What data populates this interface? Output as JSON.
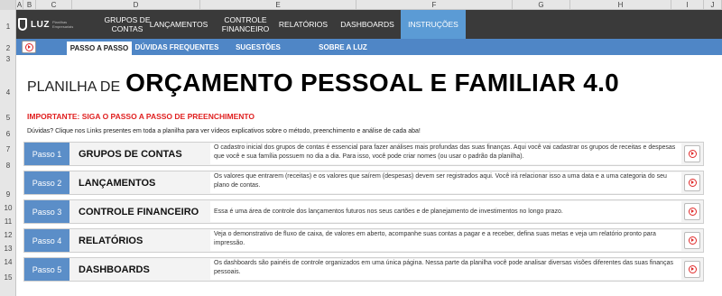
{
  "columns": [
    "A",
    "B",
    "C",
    "D",
    "E",
    "F",
    "G",
    "H",
    "I",
    "J"
  ],
  "rows": [
    "1",
    "2",
    "3",
    "4",
    "5",
    "6",
    "7",
    "8",
    "9",
    "10",
    "11",
    "12",
    "13",
    "14",
    "15"
  ],
  "logo": {
    "text": "LUZ",
    "subtitle": "Planilhas Empresariais"
  },
  "nav": {
    "items": [
      {
        "label": "GRUPOS DE CONTAS"
      },
      {
        "label": "LANÇAMENTOS"
      },
      {
        "label": "CONTROLE FINANCEIRO"
      },
      {
        "label": "RELATÓRIOS"
      },
      {
        "label": "DASHBOARDS"
      },
      {
        "label": "INSTRUÇÕES"
      }
    ]
  },
  "subnav": {
    "tabs": [
      {
        "label": "PASSO A PASSO"
      },
      {
        "label": "DÚVIDAS FREQUENTES"
      },
      {
        "label": "SUGESTÕES"
      },
      {
        "label": "SOBRE A LUZ"
      }
    ]
  },
  "title": {
    "prefix": "PLANILHA DE",
    "main": "ORÇAMENTO PESSOAL E FAMILIAR 4.0"
  },
  "important": "IMPORTANTE: SIGA O PASSO A PASSO DE PREENCHIMENTO",
  "doubts": "Dúvidas? Clique nos Links presentes em toda a planilha para ver vídeos explicativos sobre o método, preenchimento e análise de cada aba!",
  "steps": [
    {
      "num": "Passo 1",
      "name": "GRUPOS DE CONTAS",
      "desc": "O cadastro inicial dos grupos de contas é essencial para fazer análises mais profundas das suas finanças. Aqui você vai cadastrar os grupos de receitas e despesas que você e sua família possuem no dia a dia. Para isso, você pode criar nomes (ou usar o padrão da planilha)."
    },
    {
      "num": "Passo 2",
      "name": "LANÇAMENTOS",
      "desc": "Os valores que entrarem (receitas) e os valores que saírem (despesas) devem ser registrados aqui. Você irá relacionar isso a uma data e a uma categoria do seu plano de contas."
    },
    {
      "num": "Passo 3",
      "name": "CONTROLE FINANCEIRO",
      "desc": "Essa é uma área de controle dos lançamentos futuros nos seus cartões e de planejamento de investimentos no longo prazo."
    },
    {
      "num": "Passo 4",
      "name": "RELATÓRIOS",
      "desc": "Veja o demonstrativo de fluxo de caixa, de valores em aberto, acompanhe suas contas a pagar e a receber, defina suas metas e veja um relatório pronto para impressão."
    },
    {
      "num": "Passo 5",
      "name": "DASHBOARDS",
      "desc": "Os dashboards são painéis de controle organizados em uma única página. Nessa parte da planilha você pode analisar diversas visões diferentes das suas finanças pessoais."
    }
  ]
}
